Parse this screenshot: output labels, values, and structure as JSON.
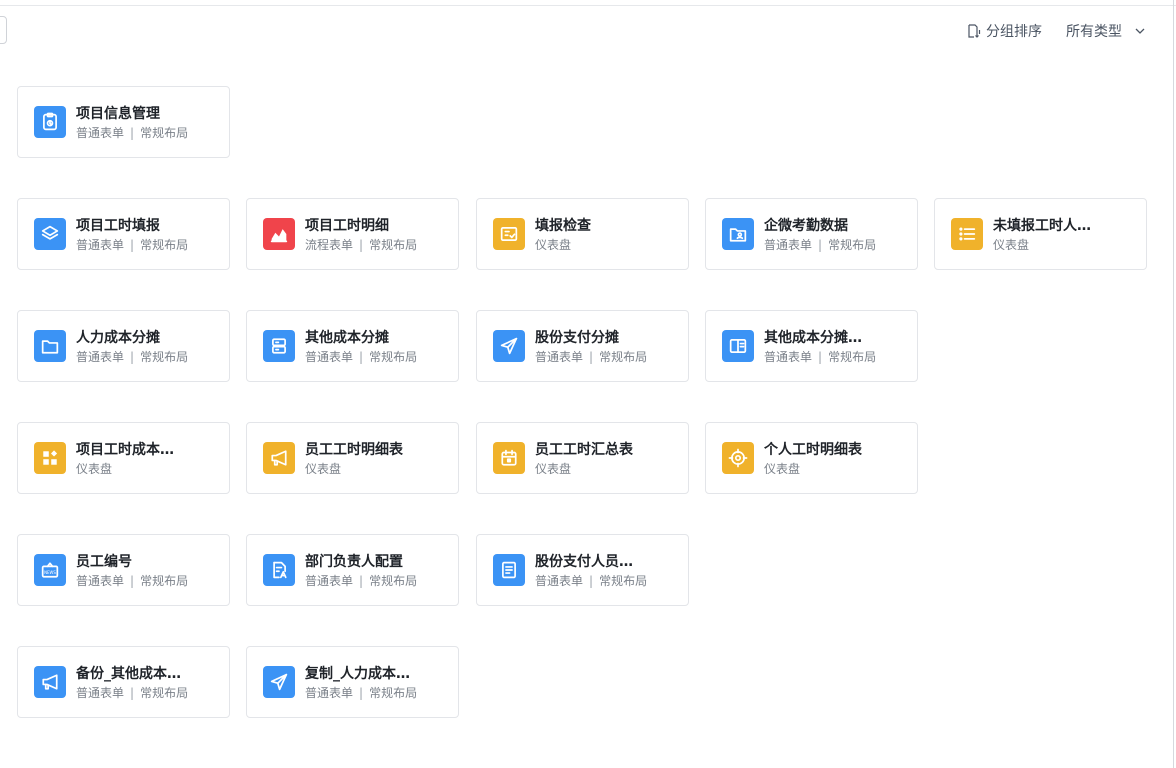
{
  "toolbar": {
    "sort_label": "分组排序",
    "type_label": "所有类型"
  },
  "colors": {
    "blue": "#3b93f5",
    "red": "#f0444b",
    "yellow": "#f0b22b"
  },
  "cards": [
    {
      "title": "项目信息管理",
      "type": "普通表单",
      "layout": "常规布局",
      "icon": "clipboard-icon",
      "color": "blue"
    },
    {
      "title": "项目工时填报",
      "type": "普通表单",
      "layout": "常规布局",
      "icon": "layers-icon",
      "color": "blue"
    },
    {
      "title": "项目工时明细",
      "type": "流程表单",
      "layout": "常规布局",
      "icon": "area-chart-icon",
      "color": "red"
    },
    {
      "title": "填报检查",
      "type": "仪表盘",
      "layout": "",
      "icon": "report-check-icon",
      "color": "yellow"
    },
    {
      "title": "企微考勤数据",
      "type": "普通表单",
      "layout": "常规布局",
      "icon": "folder-user-icon",
      "color": "blue"
    },
    {
      "title": "未填报工时人…",
      "type": "仪表盘",
      "layout": "",
      "icon": "list-icon",
      "color": "yellow"
    },
    {
      "title": "人力成本分摊",
      "type": "普通表单",
      "layout": "常规布局",
      "icon": "folder-icon",
      "color": "blue"
    },
    {
      "title": "其他成本分摊",
      "type": "普通表单",
      "layout": "常规布局",
      "icon": "server-icon",
      "color": "blue"
    },
    {
      "title": "股份支付分摊",
      "type": "普通表单",
      "layout": "常规布局",
      "icon": "send-icon",
      "color": "blue"
    },
    {
      "title": "其他成本分摊…",
      "type": "普通表单",
      "layout": "常规布局",
      "icon": "panel-icon",
      "color": "blue"
    },
    {
      "title": "项目工时成本…",
      "type": "仪表盘",
      "layout": "",
      "icon": "apps-icon",
      "color": "yellow"
    },
    {
      "title": "员工工时明细表",
      "type": "仪表盘",
      "layout": "",
      "icon": "megaphone-icon",
      "color": "yellow"
    },
    {
      "title": "员工工时汇总表",
      "type": "仪表盘",
      "layout": "",
      "icon": "calendar-icon",
      "color": "yellow"
    },
    {
      "title": "个人工时明细表",
      "type": "仪表盘",
      "layout": "",
      "icon": "target-icon",
      "color": "yellow"
    },
    {
      "title": "员工编号",
      "type": "普通表单",
      "layout": "常规布局",
      "icon": "id-badge-icon",
      "color": "blue"
    },
    {
      "title": "部门负责人配置",
      "type": "普通表单",
      "layout": "常规布局",
      "icon": "document-edit-icon",
      "color": "blue"
    },
    {
      "title": "股份支付人员…",
      "type": "普通表单",
      "layout": "常规布局",
      "icon": "document-icon",
      "color": "blue"
    },
    {
      "title": "备份_其他成本…",
      "type": "普通表单",
      "layout": "常规布局",
      "icon": "megaphone-icon",
      "color": "blue"
    },
    {
      "title": "复制_人力成本…",
      "type": "普通表单",
      "layout": "常规布局",
      "icon": "send-icon",
      "color": "blue"
    }
  ]
}
